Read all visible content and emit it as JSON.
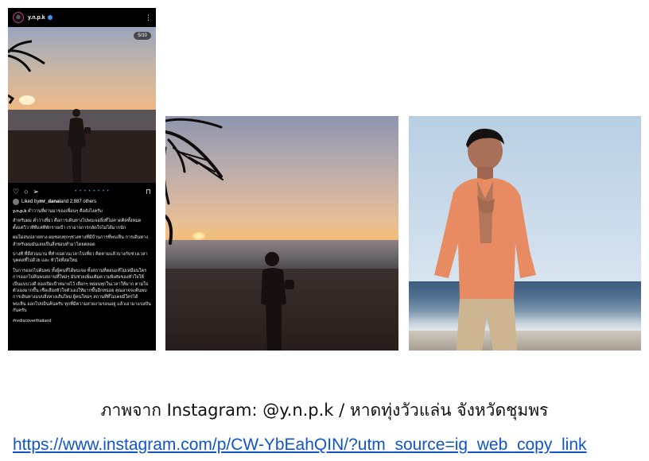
{
  "instagram_post": {
    "username": "y.n.p.k",
    "counter": "5/10",
    "liked_by_prefix": "Liked by ",
    "liked_by_user": "mr_danai",
    "liked_by_suffix": " and 2,887 others",
    "caption_user": "y.n.p.k",
    "caption_first_line": "ค่ำวานที่ผ่านมาของเพื่อนๆ คือยังไงครับ",
    "caption_paragraphs": [
      "สำหรับผม ค่ำว่าเที่ยว คือการเดินทางไปพบเจอสิ่งที่ไม่คาดคิดทั้งหมด ตั้งแต่วิวาทีทีแห่ทีพักรายเป้า เราอาจการกลัดใจไม่ได้มากนัก",
      "ผมไม่สนปลายทาง ผมชอบทุกๆช่วงทางที่มีบ้านการที่พบเห็น การเดินทางสำหรับผมมันเลยเป็นสิ่งชอบทำมาโดยตลอด",
      "บางที ที่ดีส่วนนาน ที่ทำจอด่วนเวลาไปเที่ยว คิดตามแล้วบางกับช่วงเวลา บุคคลที่ไปด้วย และ หัวใจที่สดใหม่",
      "ในการออกไปค้นพบ ทั้งผู้คนที่ได้พบเจอ ทั้งสถานที่ตอนแท้ไม่เหมือนใคร การออกไปค้นพบสถานที่ใหม่ๆ มันช่วยเพิ่มเติมความพิเศษของหัวใจให้เป็นแบบวงดี ลองเปิดเป้าหมายไว้ เลือกๆ หย่อนทุกในเวลาให้มาก ตามใจตัวเองมากขึ้น เชื่อเสียงหัวใจตัวเองให้มากขึ้นอีกหน่อย คุณอาจจะค้นพบการเดินทางแบบสิ่งทางเส้นใหม่ ผู้คนใหม่ๆ สถานที่ที่ไม่เคยมีใครได้พบเห็น ออกไปบ่ม็นค้นครับ ทุกที่มีความสวยงามรอนอยู่ แล้วเอามาแบ่งปันกันครับ"
    ],
    "hashtag": "#rediscoverthailand"
  },
  "credit_text": "ภาพจาก Instagram: @y.n.p.k / หาดทุ่งวัวแล่น จังหวัดชุมพร",
  "link_text": "https://www.instagram.com/p/CW-YbEahQIN/?utm_source=ig_web_copy_link",
  "colors": {
    "link": "#1155cc",
    "verified": "#3897f0"
  }
}
